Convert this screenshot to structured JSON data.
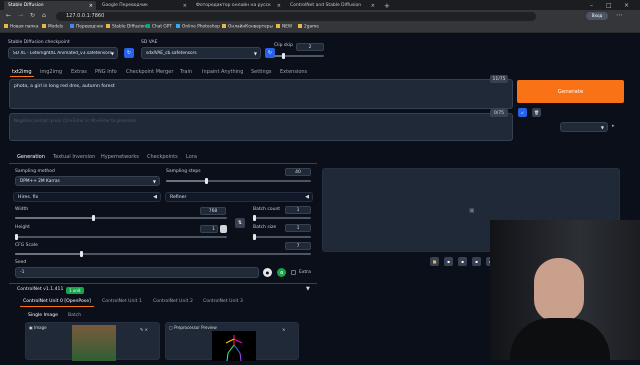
{
  "browser": {
    "tabs": [
      {
        "title": "Stable Diffusion",
        "active": true
      },
      {
        "title": "Google Переводчик"
      },
      {
        "title": "Фоторедактор онлайн на русск"
      },
      {
        "title": "ControlNet and Stable Diffusion"
      }
    ],
    "url": "127.0.0.1:7860",
    "profile_label": "Вход",
    "bookmarks": [
      "Новая папка",
      "Models",
      "Переводчик",
      "Stable Diffusion",
      "Chat GPT",
      "Online Photoshop",
      "ОнлайнКонвертеры",
      "NEW",
      "2game"
    ]
  },
  "header": {
    "checkpoint_label": "Stable Diffusion checkpoint",
    "checkpoint_value": "SD XL - LeterlightXL Animated_v3.safetensors [50",
    "vae_label": "SD VAE",
    "vae_value": "sdxlVAE_cb.safetensors",
    "clip_skip_label": "Clip skip",
    "clip_skip_value": "2"
  },
  "main_tabs": [
    "txt2img",
    "img2img",
    "Extras",
    "PNG Info",
    "Checkpoint Merger",
    "Train",
    "Inpaint Anything",
    "Settings",
    "Extensions"
  ],
  "prompt": {
    "text": "photo, a girl in long red dres, autumn forest",
    "counter": "11/75",
    "negative_placeholder": "Negative prompt (press Ctrl+Enter or Alt+Enter to generate)",
    "negative_counter": "0/75",
    "generate_label": "Generate"
  },
  "gen_tabs": [
    "Generation",
    "Textual Inversion",
    "Hypernetworks",
    "Checkpoints",
    "Lora"
  ],
  "settings": {
    "sampling_method_label": "Sampling method",
    "sampling_method_value": "DPM++ 2M Karras",
    "sampling_steps_label": "Sampling steps",
    "sampling_steps_value": "40",
    "hires_label": "Hires. fix",
    "refiner_label": "Refiner",
    "width_label": "Width",
    "width_value": "768",
    "height_label": "Height",
    "height_value": "1",
    "batch_count_label": "Batch count",
    "batch_count_value": "1",
    "batch_size_label": "Batch size",
    "batch_size_value": "1",
    "cfg_label": "CFG Scale",
    "cfg_value": "7",
    "seed_label": "Seed",
    "seed_value": "-1",
    "extra_label": "Extra"
  },
  "controlnet": {
    "title": "ControlNet v1.1.411",
    "badge": "1 unit",
    "units": [
      "ControlNet Unit 0 [OpenPose]",
      "ControlNet Unit 1",
      "ControlNet Unit 2",
      "ControlNet Unit 3"
    ],
    "image_tabs": [
      "Single Image",
      "Batch"
    ],
    "image_label": "Image",
    "preview_label": "Preprocessor Preview"
  },
  "colors": {
    "accent": "#f97316",
    "badge": "#16a34a",
    "bg": "#0b0f19",
    "panel": "#1f2937"
  }
}
